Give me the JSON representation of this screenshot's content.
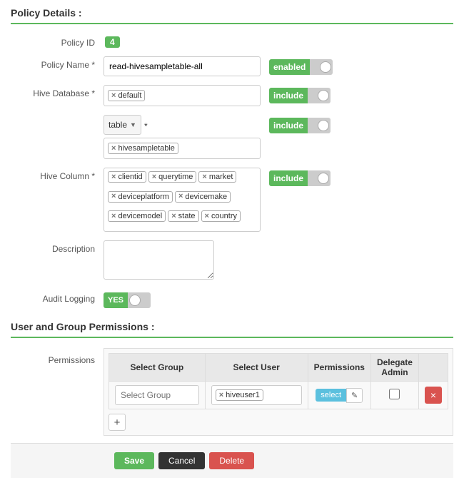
{
  "page": {
    "section1_title": "Policy Details :",
    "section2_title": "User and Group Permissions :"
  },
  "policy": {
    "id_label": "Policy ID",
    "id_value": "4",
    "name_label": "Policy Name *",
    "name_value": "read-hivesampletable-all",
    "name_toggle_label": "enabled",
    "db_label": "Hive Database *",
    "db_tag": "default",
    "db_toggle_label": "include",
    "table_label": "*",
    "table_type": "table",
    "table_tag": "hivesampletable",
    "table_toggle_label": "include",
    "column_label": "Hive Column *",
    "column_tags": [
      "clientid",
      "querytime",
      "market",
      "deviceplatform",
      "devicemake",
      "devicemodel",
      "state",
      "country"
    ],
    "column_toggle_label": "include",
    "description_label": "Description",
    "description_placeholder": "",
    "audit_label": "Audit Logging",
    "audit_yes": "YES"
  },
  "permissions": {
    "label": "Permissions",
    "col_group": "Select Group",
    "col_user": "Select User",
    "col_perm": "Permissions",
    "col_delegate_line1": "Delegate",
    "col_delegate_line2": "Admin",
    "select_group_placeholder": "Select Group",
    "user_tag": "hiveuser1",
    "perm_select_btn": "select",
    "perm_edit_icon": "✎",
    "add_btn": "+",
    "delete_btn": "×"
  },
  "footer": {
    "save": "Save",
    "cancel": "Cancel",
    "delete": "Delete"
  }
}
